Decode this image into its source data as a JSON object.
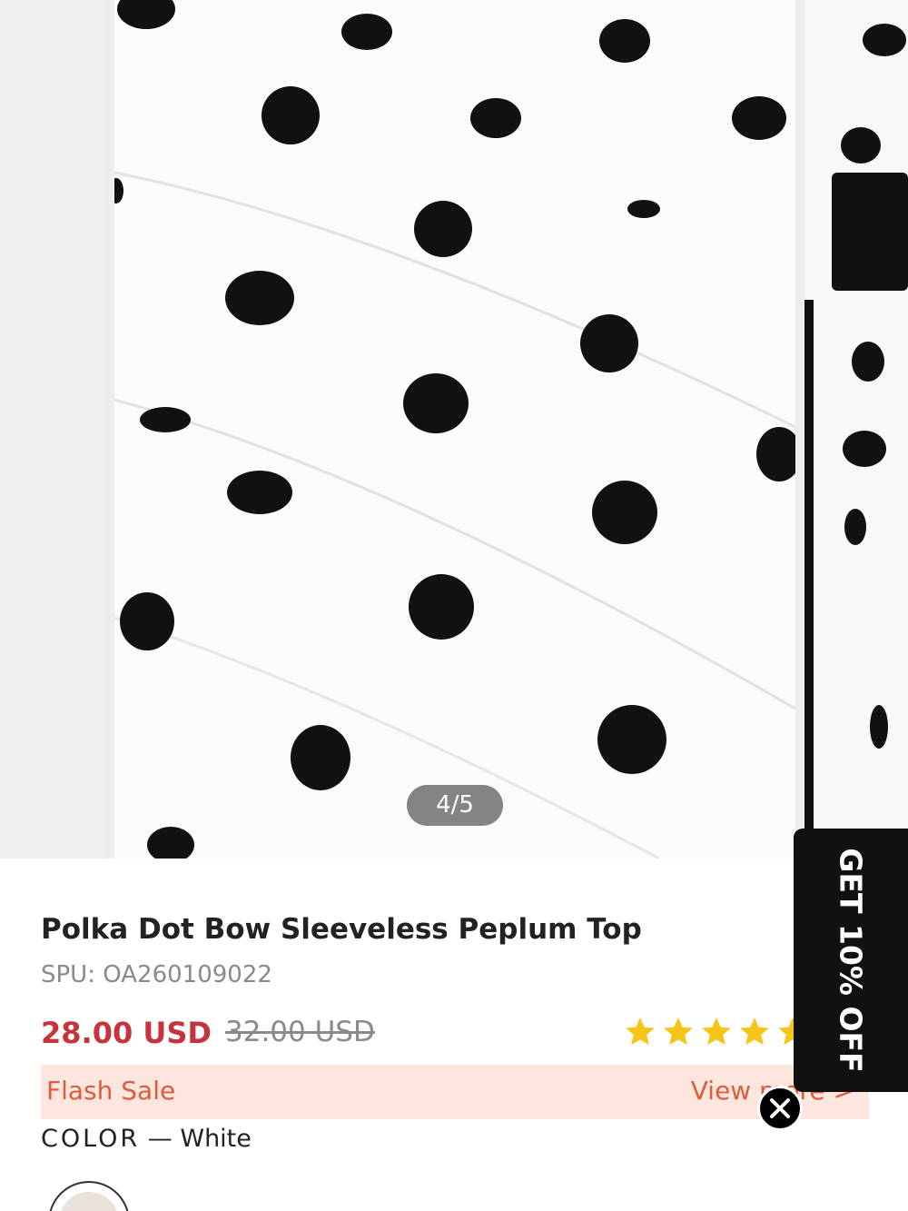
{
  "gallery": {
    "counter": "4/5",
    "current_index": 4,
    "total": 5
  },
  "product": {
    "title": "Polka Dot Bow Sleeveless Peplum Top",
    "spu": "SPU: OA260109022",
    "price": "28.00 USD",
    "original_price": "32.00 USD",
    "rating_stars": 5
  },
  "flash_sale": {
    "label": "Flash Sale",
    "link": "View more >"
  },
  "color": {
    "label": "COLOR",
    "separator": " — ",
    "value": "White"
  },
  "promo": {
    "tab_text": "GET 10% OFF"
  },
  "colors": {
    "price": "#c8323c",
    "flash_bg": "#fde6de",
    "flash_text": "#e05a3c",
    "star": "#f5c518",
    "promo_bg": "#111111"
  },
  "icons": {
    "star": "star-icon",
    "close": "close-icon",
    "chevron": "chevron-right-icon"
  }
}
